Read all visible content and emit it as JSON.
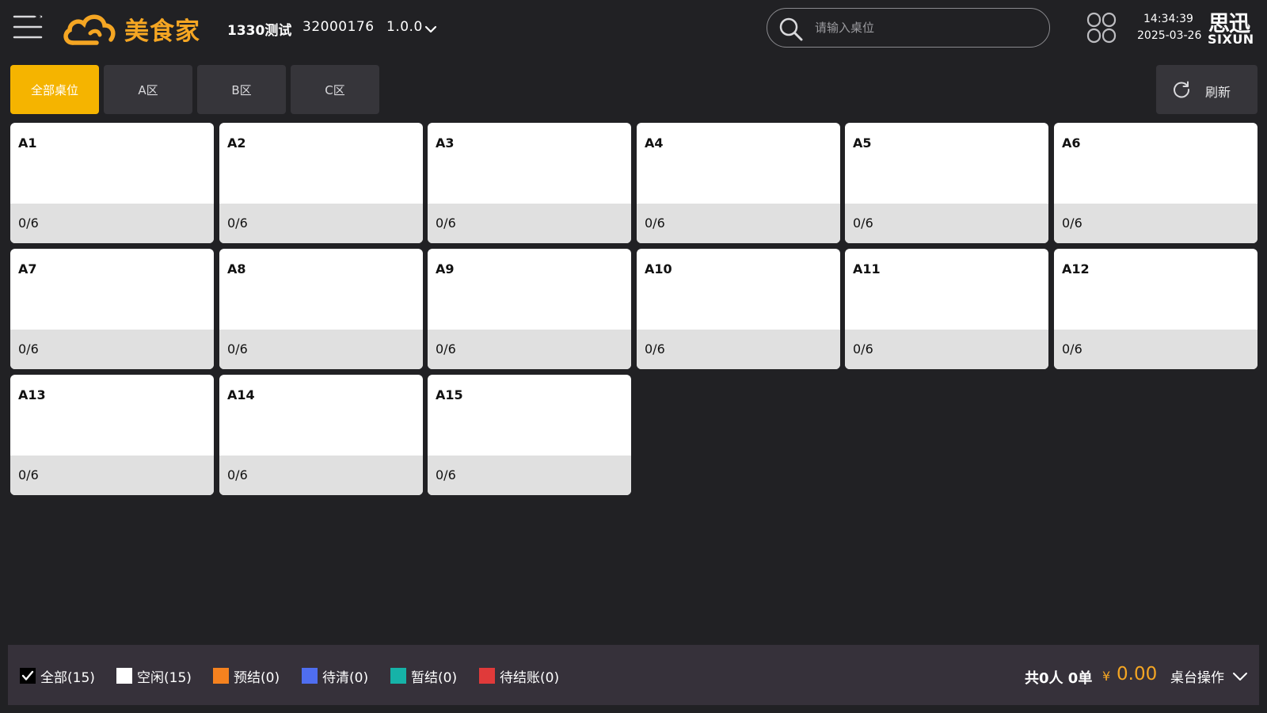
{
  "header": {
    "brand": "美食家",
    "store_name": "1330测试",
    "store_id": "32000176",
    "version": "1.0.0",
    "search_placeholder": "请输入桌位",
    "time": "14:34:39",
    "date": "2025-03-26",
    "vendor_cn": "思迅",
    "vendor_en": "SIXUN",
    "brand_color": "#f5a623"
  },
  "tabs": [
    {
      "label": "全部桌位",
      "active": true
    },
    {
      "label": "A区",
      "active": false
    },
    {
      "label": "B区",
      "active": false
    },
    {
      "label": "C区",
      "active": false
    }
  ],
  "refresh_label": "刷新",
  "tables": [
    {
      "name": "A1",
      "seats": "0/6"
    },
    {
      "name": "A2",
      "seats": "0/6"
    },
    {
      "name": "A3",
      "seats": "0/6"
    },
    {
      "name": "A4",
      "seats": "0/6"
    },
    {
      "name": "A5",
      "seats": "0/6"
    },
    {
      "name": "A6",
      "seats": "0/6"
    },
    {
      "name": "A7",
      "seats": "0/6"
    },
    {
      "name": "A8",
      "seats": "0/6"
    },
    {
      "name": "A9",
      "seats": "0/6"
    },
    {
      "name": "A10",
      "seats": "0/6"
    },
    {
      "name": "A11",
      "seats": "0/6"
    },
    {
      "name": "A12",
      "seats": "0/6"
    },
    {
      "name": "A13",
      "seats": "0/6"
    },
    {
      "name": "A14",
      "seats": "0/6"
    },
    {
      "name": "A15",
      "seats": "0/6"
    }
  ],
  "legend": [
    {
      "label": "全部(15)",
      "color": "#000000",
      "checked": true
    },
    {
      "label": "空闲(15)",
      "color": "#ffffff",
      "checked": false
    },
    {
      "label": "预结(0)",
      "color": "#f5821f",
      "checked": false
    },
    {
      "label": "待清(0)",
      "color": "#4f6ef0",
      "checked": false
    },
    {
      "label": "暂结(0)",
      "color": "#16b3a8",
      "checked": false
    },
    {
      "label": "待结账(0)",
      "color": "#e03a3a",
      "checked": false
    }
  ],
  "footer": {
    "summary": "共0人 0单",
    "currency": "¥",
    "amount": "0.00",
    "table_ops": "桌台操作"
  }
}
